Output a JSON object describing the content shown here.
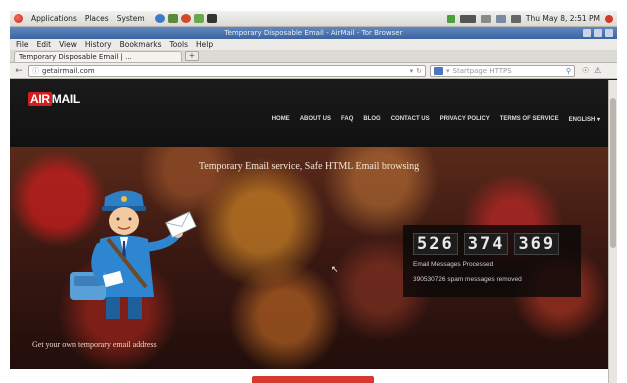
{
  "panel": {
    "menus": [
      "Applications",
      "Places",
      "System"
    ],
    "clock": "Thu May 8, 2:51 PM"
  },
  "window": {
    "title": "Temporary Disposable Email - AirMail - Tor Browser"
  },
  "menubar": [
    "File",
    "Edit",
    "View",
    "History",
    "Bookmarks",
    "Tools",
    "Help"
  ],
  "tab": {
    "label": "Temporary Disposable Email | ...",
    "new_tab": "+"
  },
  "navbar": {
    "url": "getairmail.com",
    "search_placeholder": "Startpage HTTPS"
  },
  "site": {
    "logo_air": "AIR",
    "logo_mail": "MAIL",
    "nav": [
      "HOME",
      "ABOUT US",
      "FAQ",
      "BLOG",
      "CONTACT US",
      "PRIVACY POLICY",
      "TERMS OF SERVICE",
      "ENGLISH ▾"
    ],
    "tagline": "Temporary Email service, Safe HTML Email browsing",
    "counter_digits": [
      "526",
      "374",
      "369"
    ],
    "counter_label": "Email Messages Processed",
    "spam_label": "390530726 spam messages removed",
    "cta": "Get your own temporary email address"
  },
  "colors": {
    "logo_red": "#d11f1f",
    "titlebar_blue": "#4a74b0",
    "cta_button": "#d63a2f"
  }
}
